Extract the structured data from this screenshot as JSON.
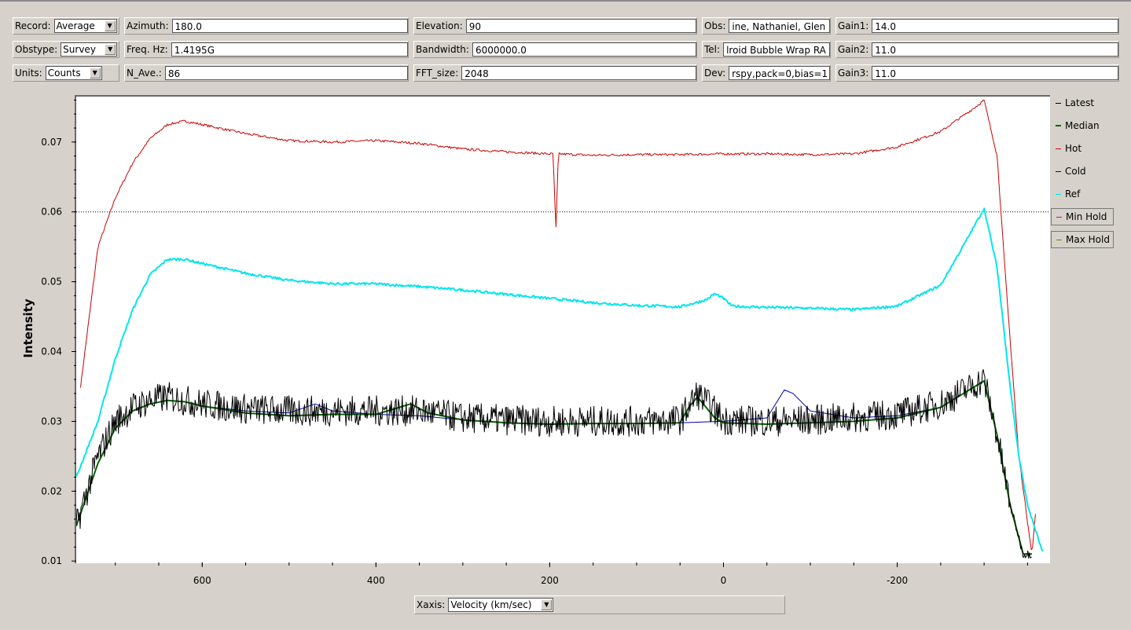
{
  "controls": {
    "record": {
      "label": "Record:",
      "value": "Average"
    },
    "obstype": {
      "label": "Obstype:",
      "value": "Survey"
    },
    "units": {
      "label": "Units:",
      "value": "Counts"
    },
    "azimuth": {
      "label": "Azimuth:",
      "value": "180.0"
    },
    "freq": {
      "label": "Freq. Hz:",
      "value": "1.4195G"
    },
    "nave": {
      "label": "N_Ave.:",
      "value": "86"
    },
    "elevation": {
      "label": "Elevation:",
      "value": "90"
    },
    "bandwidth": {
      "label": "Bandwidth:",
      "value": "6000000.0"
    },
    "fftsize": {
      "label": "FFT_size:",
      "value": "2048"
    },
    "obs": {
      "label": "Obs:",
      "value": "ine, Nathaniel, Glen"
    },
    "tel": {
      "label": "Tel:",
      "value": "lroid Bubble Wrap RA"
    },
    "dev": {
      "label": "Dev:",
      "value": "rspy,pack=0,bias=1"
    },
    "gain1": {
      "label": "Gain1:",
      "value": "14.0"
    },
    "gain2": {
      "label": "Gain2:",
      "value": "11.0"
    },
    "gain3": {
      "label": "Gain3:",
      "value": "11.0"
    }
  },
  "xaxis_control": {
    "label": "Xaxis:",
    "value": "Velocity (km/sec)"
  },
  "legend": [
    {
      "label": "Latest",
      "color": "#000000",
      "boxed": false
    },
    {
      "label": "Median",
      "color": "#006400",
      "boxed": false
    },
    {
      "label": "Hot",
      "color": "#cc0000",
      "boxed": false
    },
    {
      "label": "Cold",
      "color": "#0000aa",
      "boxed": false
    },
    {
      "label": "Ref",
      "color": "#00e5ee",
      "boxed": false
    },
    {
      "label": "Min Hold",
      "color": "#cc00cc",
      "boxed": true
    },
    {
      "label": "Max Hold",
      "color": "#808000",
      "boxed": true
    }
  ],
  "chart_data": {
    "type": "line",
    "title": "",
    "xlabel": "",
    "ylabel": "Intensity",
    "x_reversed": true,
    "xlim": [
      745,
      -375
    ],
    "ylim": [
      0.0098,
      0.0765
    ],
    "x_ticks": [
      600,
      400,
      200,
      0,
      -200
    ],
    "y_ticks": [
      0.01,
      0.02,
      0.03,
      0.04,
      0.05,
      0.06,
      0.07
    ],
    "hline": 0.06,
    "series": [
      {
        "name": "Hot",
        "color": "#cc0000",
        "x": [
          740,
          720,
          700,
          680,
          660,
          640,
          620,
          600,
          550,
          500,
          450,
          400,
          350,
          300,
          250,
          200,
          196,
          193,
          190,
          150,
          100,
          50,
          0,
          -50,
          -100,
          -150,
          -200,
          -250,
          -290,
          -300,
          -315,
          -325,
          -340,
          -355,
          -360
        ],
        "y": [
          0.035,
          0.055,
          0.062,
          0.067,
          0.0705,
          0.0725,
          0.073,
          0.0725,
          0.0712,
          0.0702,
          0.07,
          0.0702,
          0.0698,
          0.069,
          0.0686,
          0.0683,
          0.0683,
          0.057,
          0.0683,
          0.0681,
          0.0682,
          0.0682,
          0.0683,
          0.0683,
          0.0682,
          0.0683,
          0.0693,
          0.0715,
          0.075,
          0.076,
          0.068,
          0.05,
          0.025,
          0.011,
          0.018
        ]
      },
      {
        "name": "Ref",
        "color": "#00e5ee",
        "x": [
          745,
          720,
          700,
          680,
          660,
          640,
          620,
          600,
          550,
          500,
          450,
          400,
          350,
          300,
          250,
          200,
          150,
          100,
          50,
          20,
          10,
          0,
          -10,
          -30,
          -100,
          -150,
          -200,
          -250,
          -280,
          -300,
          -315,
          -330,
          -340,
          -350,
          -368
        ],
        "y": [
          0.022,
          0.03,
          0.039,
          0.046,
          0.051,
          0.0532,
          0.0532,
          0.0526,
          0.0512,
          0.0502,
          0.0497,
          0.0497,
          0.0493,
          0.0488,
          0.0482,
          0.0476,
          0.047,
          0.0466,
          0.0464,
          0.0474,
          0.0483,
          0.0476,
          0.0465,
          0.0464,
          0.0462,
          0.046,
          0.0465,
          0.0495,
          0.056,
          0.0605,
          0.052,
          0.035,
          0.025,
          0.018,
          0.011
        ]
      },
      {
        "name": "Cold",
        "color": "#0000aa",
        "x": [
          745,
          720,
          700,
          680,
          660,
          640,
          620,
          600,
          550,
          500,
          470,
          450,
          400,
          350,
          300,
          250,
          200,
          150,
          100,
          50,
          0,
          -50,
          -70,
          -80,
          -100,
          -150,
          -200,
          -250,
          -300,
          -315,
          -330,
          -345,
          -355
        ],
        "y": [
          0.015,
          0.024,
          0.029,
          0.0315,
          0.0325,
          0.033,
          0.0328,
          0.0322,
          0.0315,
          0.0312,
          0.0325,
          0.0315,
          0.031,
          0.0308,
          0.0302,
          0.0298,
          0.0296,
          0.0297,
          0.0297,
          0.0298,
          0.03,
          0.0305,
          0.0345,
          0.034,
          0.0315,
          0.0305,
          0.0308,
          0.032,
          0.0358,
          0.028,
          0.018,
          0.011,
          0.011
        ]
      },
      {
        "name": "Median",
        "color": "#006400",
        "x": [
          745,
          720,
          700,
          680,
          660,
          640,
          620,
          600,
          550,
          500,
          450,
          400,
          360,
          340,
          300,
          250,
          200,
          150,
          100,
          50,
          40,
          30,
          20,
          10,
          0,
          -50,
          -100,
          -150,
          -200,
          -250,
          -300,
          -315,
          -330,
          -345,
          -355
        ],
        "y": [
          0.015,
          0.024,
          0.029,
          0.0315,
          0.0325,
          0.033,
          0.0328,
          0.0322,
          0.0312,
          0.0308,
          0.031,
          0.031,
          0.0325,
          0.0312,
          0.0302,
          0.0298,
          0.0296,
          0.0297,
          0.0297,
          0.0298,
          0.032,
          0.0335,
          0.032,
          0.0305,
          0.0298,
          0.0296,
          0.0298,
          0.03,
          0.0305,
          0.032,
          0.0358,
          0.028,
          0.018,
          0.011,
          0.011
        ]
      },
      {
        "name": "Latest",
        "color": "#000000",
        "x": [
          745,
          720,
          700,
          680,
          660,
          640,
          620,
          600,
          550,
          500,
          450,
          400,
          350,
          300,
          250,
          200,
          150,
          100,
          50,
          30,
          0,
          -50,
          -100,
          -150,
          -200,
          -250,
          -300,
          -315,
          -330,
          -345,
          -355
        ],
        "y": [
          0.015,
          0.025,
          0.03,
          0.032,
          0.033,
          0.0335,
          0.033,
          0.0325,
          0.0318,
          0.0315,
          0.0315,
          0.0315,
          0.0315,
          0.0305,
          0.0302,
          0.03,
          0.03,
          0.03,
          0.0302,
          0.034,
          0.0302,
          0.03,
          0.0302,
          0.0305,
          0.031,
          0.0325,
          0.036,
          0.028,
          0.018,
          0.011,
          0.011
        ]
      }
    ]
  }
}
